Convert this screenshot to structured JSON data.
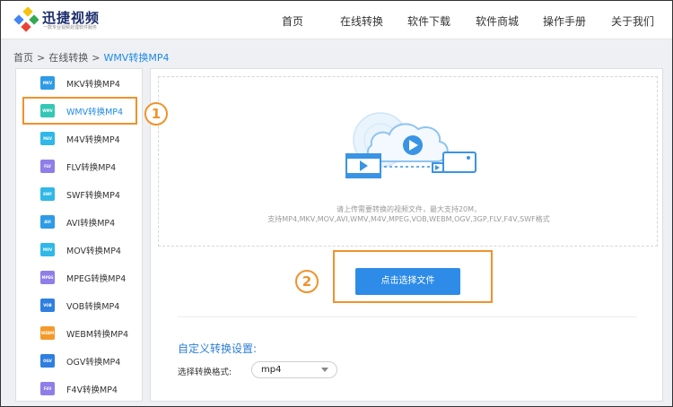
{
  "header": {
    "logo_title": "迅捷视频",
    "logo_subtitle": "一款专业视频处理软件服务",
    "nav": [
      "首页",
      "在线转换",
      "软件下载",
      "软件商城",
      "操作手册",
      "关于我们"
    ]
  },
  "breadcrumb": {
    "items": [
      "首页",
      "在线转换",
      "WMV转换MP4"
    ],
    "separator": ">"
  },
  "sidebar": {
    "items": [
      {
        "icon": "MKV",
        "label": "MKV转换MP4",
        "color": "#2e9be6"
      },
      {
        "icon": "WMV",
        "label": "WMV转换MP4",
        "color": "#34c7b5"
      },
      {
        "icon": "M4V",
        "label": "M4V转换MP4",
        "color": "#2fb8e8"
      },
      {
        "icon": "FLV",
        "label": "FLV转换MP4",
        "color": "#8f7ee8"
      },
      {
        "icon": "SWF",
        "label": "SWF转换MP4",
        "color": "#2fb8e8"
      },
      {
        "icon": "AVI",
        "label": "AVI转换MP4",
        "color": "#2e9be6"
      },
      {
        "icon": "MOV",
        "label": "MOV转换MP4",
        "color": "#2fb8e8"
      },
      {
        "icon": "MPEG",
        "label": "MPEG转换MP4",
        "color": "#8f7ee8"
      },
      {
        "icon": "VOB",
        "label": "VOB转换MP4",
        "color": "#2e7fe0"
      },
      {
        "icon": "WEBM",
        "label": "WEBM转换MP4",
        "color": "#f39a2b"
      },
      {
        "icon": "OGV",
        "label": "OGV转换MP4",
        "color": "#2e7fe0"
      },
      {
        "icon": "F4V",
        "label": "F4V转换MP4",
        "color": "#8f7ee8"
      }
    ]
  },
  "main": {
    "upload_hint_1": "请上传需要转换的视频文件，最大支持20M，",
    "upload_hint_2": "支持MP4,MKV,MOV,AVI,WMV,M4V,MPEG,VOB,WEBM,OGV,3GP,FLV,F4V,SWF格式",
    "choose_button": "点击选择文件",
    "settings_title": "自定义转换设置:",
    "format_label": "选择转换格式:",
    "format_value": "mp4"
  },
  "annotations": {
    "step1": "1",
    "step2": "2",
    "color": "#f0922b"
  },
  "colors": {
    "accent": "#2e8ce8",
    "link": "#1f8ae6"
  }
}
